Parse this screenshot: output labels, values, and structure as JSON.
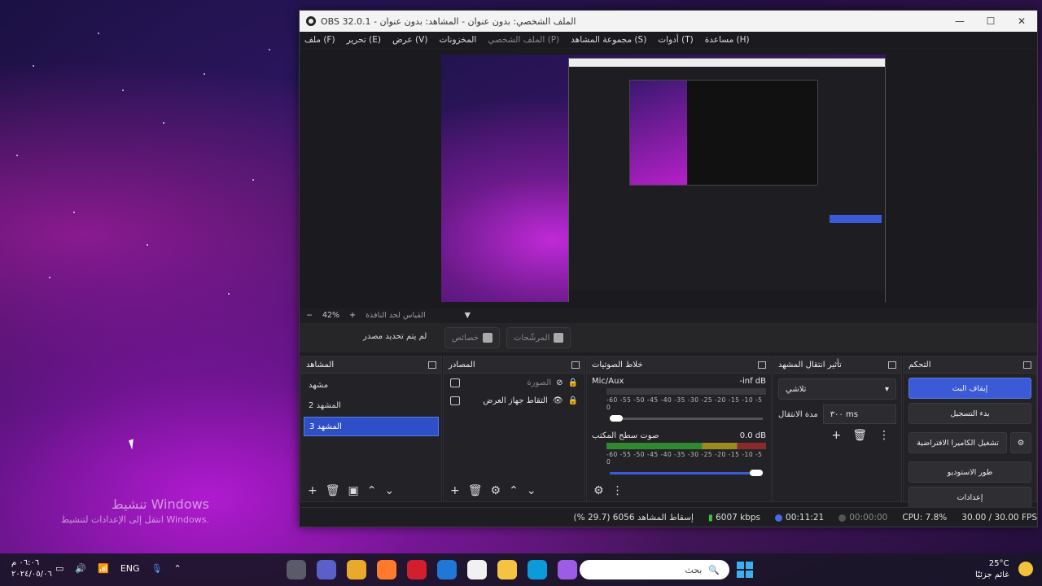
{
  "window": {
    "title": "OBS 32.0.1 - الملف الشخصي: بدون عنوان - المشاهد: بدون عنوان",
    "controls": {
      "minimize": "—",
      "maximize": "☐",
      "close": "✕"
    }
  },
  "menu": [
    "ملف (F)",
    "تحرير (E)",
    "عرض (V)",
    "المخزونات",
    "الملف الشخصي (P)",
    "مجموعة المشاهد (S)",
    "أدوات (T)",
    "مساعدة (H)"
  ],
  "preview_toolbar": {
    "minus": "−",
    "zoom": "42%",
    "plus": "+",
    "fit": "القياس لحد النافذة",
    "dropdown": "▼"
  },
  "source_bar": {
    "no_source": "لم يتم تحديد مصدر",
    "properties": "خصائص",
    "filters": "المرشّحات"
  },
  "scenes": {
    "title": "المشاهد",
    "items": [
      {
        "label": "مشهد",
        "selected": false
      },
      {
        "label": "المشهد 2",
        "selected": false
      },
      {
        "label": "المشهد 3",
        "selected": true
      }
    ],
    "footer": [
      "+",
      "🗑",
      "▣",
      "⌃",
      "⌄"
    ]
  },
  "sources": {
    "title": "المصادر",
    "items": [
      {
        "label": "الصورة",
        "hidden": true
      },
      {
        "label": "التقاط جهاز العرض",
        "hidden": false
      }
    ],
    "footer": [
      "+",
      "🗑",
      "⚙",
      "⌃",
      "⌄"
    ]
  },
  "mixer": {
    "title": "خلاط الصوتيات",
    "channels": [
      {
        "name": "Mic/Aux",
        "level": "-inf dB",
        "active": false,
        "volume": 0.05
      },
      {
        "name": "صوت سطح المكتب",
        "level": "0.0 dB",
        "active": true,
        "volume": 1.0
      }
    ],
    "ticks": "-60 -55 -50 -45 -40 -35 -30 -25 -20 -15 -10 -5 0"
  },
  "transitions": {
    "title": "تأثير انتقال المشهد",
    "selected": "تلاشي",
    "duration_label": "مدة الانتقال",
    "duration": "٣٠٠ ms"
  },
  "controls": {
    "title": "التحكم",
    "buttons": [
      "إيقاف البث",
      "بدء التسجيل",
      "تشغيل الكاميرا الافتراضية",
      "طور الاستوديو",
      "إعدادات"
    ]
  },
  "status": {
    "dropped": "إسقاط المشاهد 6056 (29.7 %)",
    "bitrate": "6007 kbps",
    "stream_time": "00:11:21",
    "rec_time": "00:00:00",
    "cpu": "CPU: 7.8%",
    "fps": "30.00 / 30.00 FPS"
  },
  "desktop": {
    "watermark_title": "تنشيط Windows",
    "watermark_sub": "انتقل إلى الإعدادات لتنشيط Windows."
  },
  "taskbar": {
    "time": "٠٦:٠٦ م",
    "date": "٢٠٢٤/٠٥/٠٦",
    "lang": "ENG",
    "search_placeholder": "بحث",
    "weather_temp": "25°C",
    "weather_desc": "غائم جزئيًا",
    "app_colors": [
      "#5a5a6a",
      "#5b5fc7",
      "#e9a92b",
      "#ff7a2a",
      "#d21f2f",
      "#1f77d6",
      "#f1f1f1",
      "#f5c242",
      "#0a9bd8",
      "#9c5ce6"
    ]
  }
}
